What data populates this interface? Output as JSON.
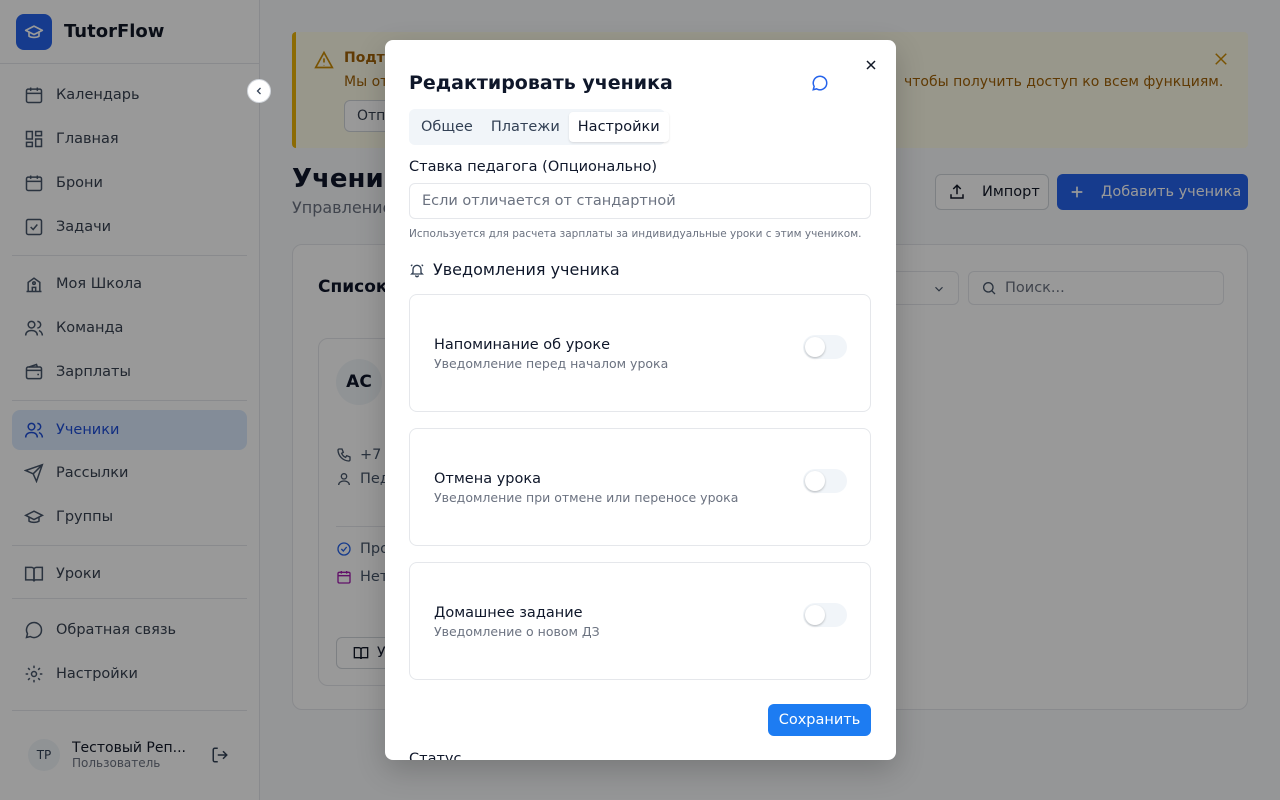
{
  "app": {
    "name": "TutorFlow"
  },
  "sidebar": {
    "items": [
      {
        "label": "Календарь",
        "icon": "calendar-icon"
      },
      {
        "label": "Главная",
        "icon": "dashboard-icon"
      },
      {
        "label": "Брони",
        "icon": "calendar-icon"
      },
      {
        "label": "Задачи",
        "icon": "check-square-icon"
      },
      {
        "label": "Моя Школа",
        "icon": "school-icon"
      },
      {
        "label": "Команда",
        "icon": "users-icon"
      },
      {
        "label": "Зарплаты",
        "icon": "wallet-icon"
      },
      {
        "label": "Ученики",
        "icon": "users-icon",
        "active": true
      },
      {
        "label": "Рассылки",
        "icon": "send-icon"
      },
      {
        "label": "Группы",
        "icon": "graduation-cap-icon"
      },
      {
        "label": "Уроки",
        "icon": "book-icon"
      },
      {
        "label": "Обратная связь",
        "icon": "message-circle-icon"
      },
      {
        "label": "Настройки",
        "icon": "gear-icon"
      }
    ],
    "user": {
      "initials": "ТР",
      "name": "Тестовый Реп...",
      "role": "Пользователь"
    }
  },
  "banner": {
    "title": "Подт",
    "text_left": "Мы от",
    "text_right": "чтобы получить доступ ко всем функциям.",
    "button": "Отп"
  },
  "page": {
    "title": "Учени",
    "subtitle": "Управление",
    "import_label": "Импорт",
    "add_label": "Добавить ученика",
    "list_title": "Список",
    "search_placeholder": "Поиск..."
  },
  "student_card": {
    "initials": "АС",
    "phone": "+7",
    "teacher": "Пед",
    "status": "Про",
    "schedule": "Нет",
    "button": "У"
  },
  "modal": {
    "title": "Редактировать ученика",
    "tabs": [
      {
        "label": "Общее"
      },
      {
        "label": "Платежи"
      },
      {
        "label": "Настройки",
        "active": true
      }
    ],
    "rate_label": "Ставка педагога (Опционально)",
    "rate_placeholder": "Если отличается от стандартной",
    "rate_hint": "Используется для расчета зарплаты за индивидуальные уроки с этим учеником.",
    "notifications_title": "Уведомления ученика",
    "notifications": [
      {
        "title": "Напоминание об уроке",
        "desc": "Уведомление перед началом урока",
        "enabled": false
      },
      {
        "title": "Отмена урока",
        "desc": "Уведомление при отмене или переносе урока",
        "enabled": false
      },
      {
        "title": "Домашнее задание",
        "desc": "Уведомление о новом ДЗ",
        "enabled": false
      }
    ],
    "save_label": "Сохранить",
    "status_label": "Статус"
  },
  "colors": {
    "accent": "#2563eb",
    "save": "#1d7cf2",
    "warning": "#eab308",
    "active_nav_bg": "#dbeafe"
  }
}
